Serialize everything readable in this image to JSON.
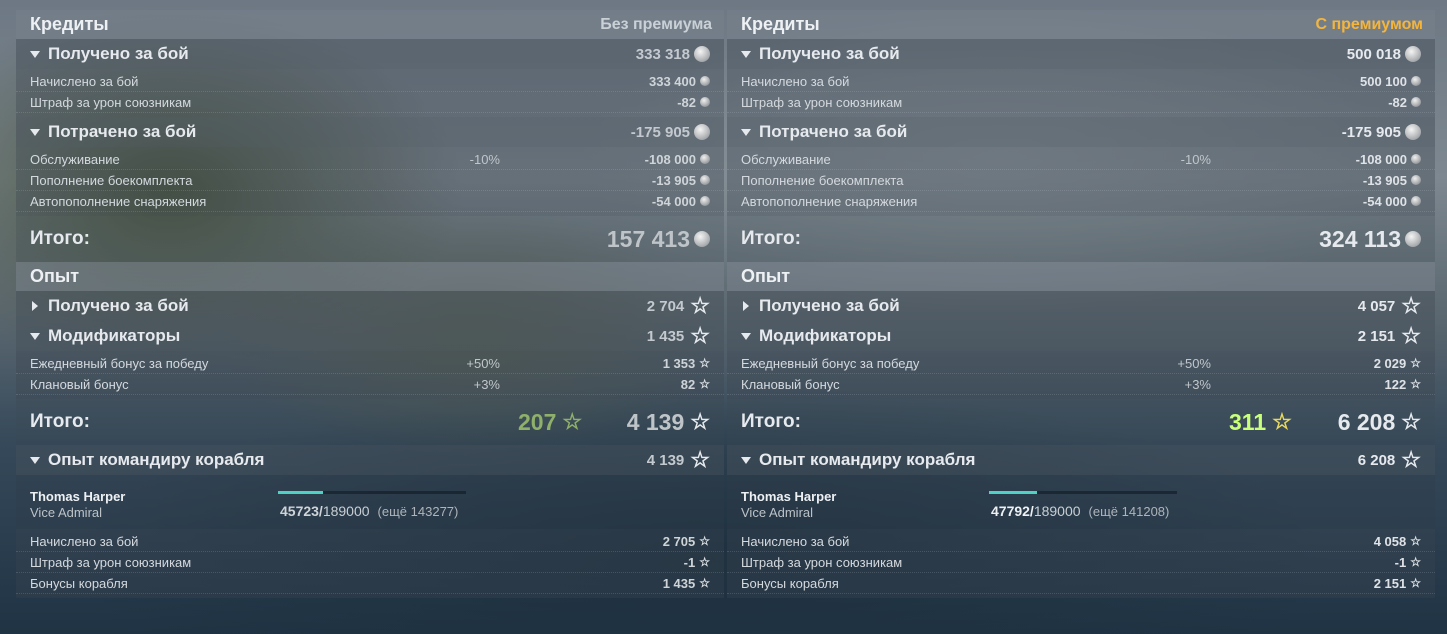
{
  "panels": [
    {
      "credits": {
        "title": "Кредиты",
        "premium_label": "Без премиума",
        "earned": {
          "label": "Получено за бой",
          "value": "333 318"
        },
        "earned_rows": [
          {
            "label": "Начислено за бой",
            "pct": "",
            "value": "333 400"
          },
          {
            "label": "Штраф за урон союзникам",
            "pct": "",
            "value": "-82"
          }
        ],
        "spent": {
          "label": "Потрачено за бой",
          "value": "-175 905"
        },
        "spent_rows": [
          {
            "label": "Обслуживание",
            "pct": "-10%",
            "value": "-108 000"
          },
          {
            "label": "Пополнение боекомплекта",
            "pct": "",
            "value": "-13 905"
          },
          {
            "label": "Автопополнение снаряжения",
            "pct": "",
            "value": "-54 000"
          }
        ],
        "total_label": "Итого:",
        "total_value": "157 413"
      },
      "xp": {
        "title": "Опыт",
        "earned": {
          "label": "Получено за бой",
          "value": "2 704"
        },
        "modifiers": {
          "label": "Модификаторы",
          "value": "1 435"
        },
        "modifier_rows": [
          {
            "label": "Ежедневный бонус за победу",
            "pct": "+50%",
            "value": "1 353"
          },
          {
            "label": "Клановый бонус",
            "pct": "+3%",
            "value": "82"
          }
        ],
        "total_label": "Итого:",
        "bonus_value": "207",
        "total_value": "4 139"
      },
      "commander": {
        "header_label": "Опыт командиру корабля",
        "header_value": "4 139",
        "name": "Thomas Harper",
        "rank": "Vice Admiral",
        "xp_current": "45723/",
        "xp_max": "189000",
        "xp_remaining": "(ещё 143277)",
        "progress": 0.2419,
        "rows": [
          {
            "label": "Начислено за бой",
            "value": "2 705"
          },
          {
            "label": "Штраф за урон союзникам",
            "value": "-1"
          },
          {
            "label": "Бонусы корабля",
            "value": "1 435"
          }
        ]
      }
    },
    {
      "credits": {
        "title": "Кредиты",
        "premium_label": "С премиумом",
        "earned": {
          "label": "Получено за бой",
          "value": "500 018"
        },
        "earned_rows": [
          {
            "label": "Начислено за бой",
            "pct": "",
            "value": "500 100"
          },
          {
            "label": "Штраф за урон союзникам",
            "pct": "",
            "value": "-82"
          }
        ],
        "spent": {
          "label": "Потрачено за бой",
          "value": "-175 905"
        },
        "spent_rows": [
          {
            "label": "Обслуживание",
            "pct": "-10%",
            "value": "-108 000"
          },
          {
            "label": "Пополнение боекомплекта",
            "pct": "",
            "value": "-13 905"
          },
          {
            "label": "Автопополнение снаряжения",
            "pct": "",
            "value": "-54 000"
          }
        ],
        "total_label": "Итого:",
        "total_value": "324 113"
      },
      "xp": {
        "title": "Опыт",
        "earned": {
          "label": "Получено за бой",
          "value": "4 057"
        },
        "modifiers": {
          "label": "Модификаторы",
          "value": "2 151"
        },
        "modifier_rows": [
          {
            "label": "Ежедневный бонус за победу",
            "pct": "+50%",
            "value": "2 029"
          },
          {
            "label": "Клановый бонус",
            "pct": "+3%",
            "value": "122"
          }
        ],
        "total_label": "Итого:",
        "bonus_value": "311",
        "total_value": "6 208"
      },
      "commander": {
        "header_label": "Опыт командиру корабля",
        "header_value": "6 208",
        "name": "Thomas Harper",
        "rank": "Vice Admiral",
        "xp_current": "47792/",
        "xp_max": "189000",
        "xp_remaining": "(ещё 141208)",
        "progress": 0.2529,
        "rows": [
          {
            "label": "Начислено за бой",
            "value": "4 058"
          },
          {
            "label": "Штраф за урон союзникам",
            "value": "-1"
          },
          {
            "label": "Бонусы корабля",
            "value": "2 151"
          }
        ]
      }
    }
  ]
}
